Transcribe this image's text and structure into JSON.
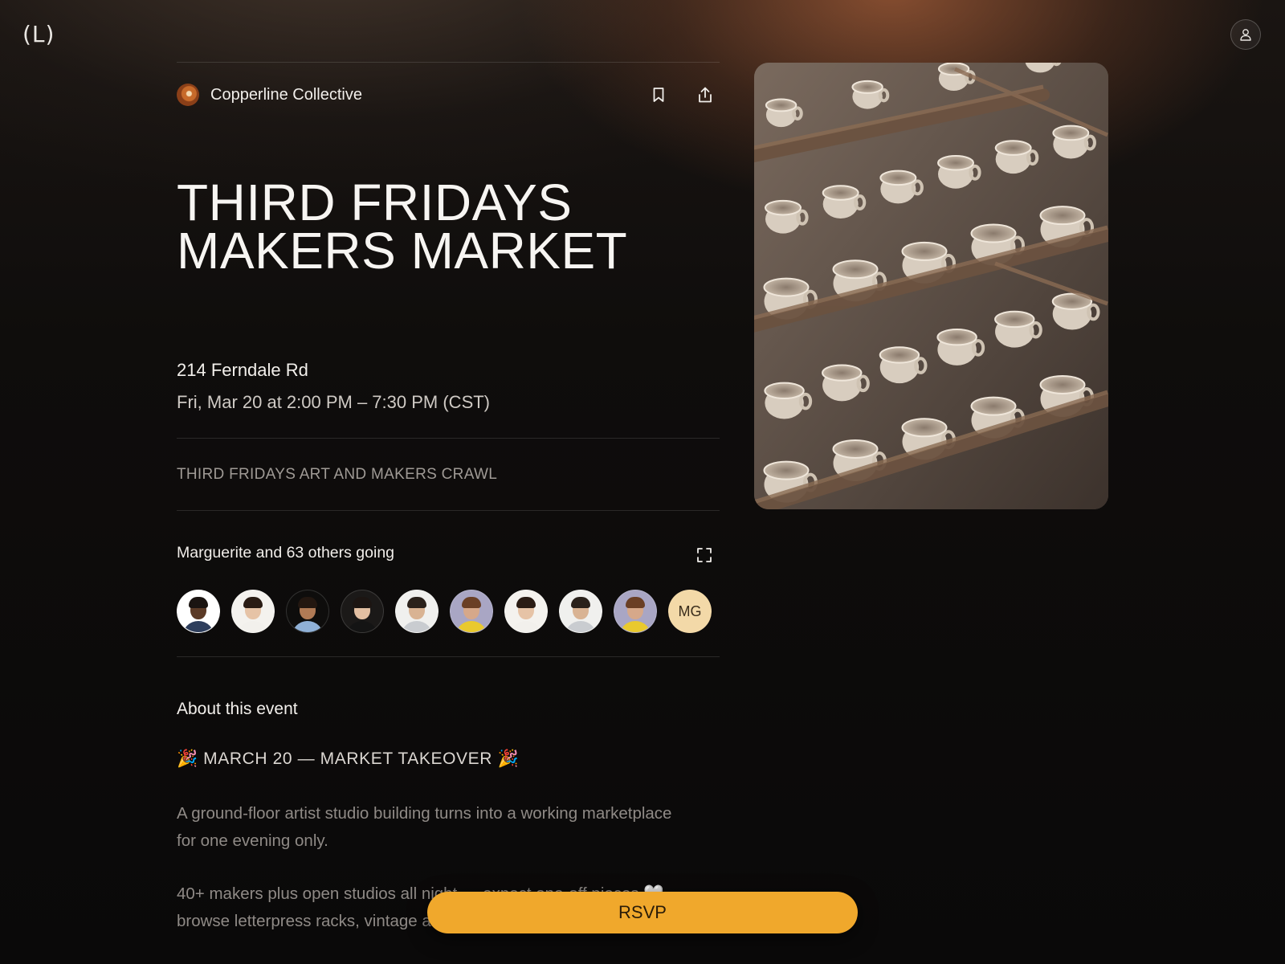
{
  "app": {
    "logo_text": "(L)"
  },
  "header": {
    "account_icon": "person-icon"
  },
  "event": {
    "host_name": "Copperline Collective",
    "title_line_1": "THIRD FRIDAYS",
    "title_line_2": "MAKERS MARKET",
    "location": "214 Ferndale Rd",
    "datetime": "Fri, Mar 20 at 2:00 PM – 7:30 PM (CST)",
    "series": "THIRD FRIDAYS ART AND MAKERS CRAWL",
    "actions": {
      "save_icon": "bookmark-icon",
      "share_icon": "share-icon"
    }
  },
  "attendees": {
    "summary": "Marguerite and 63 others going",
    "expand_icon": "expand-icon",
    "avatars": [
      {
        "kind": "photo",
        "skin": "#5b3a26",
        "hair": "#1a1411",
        "shirt": "#2e3e5c",
        "bg": "#ffffff"
      },
      {
        "kind": "photo",
        "skin": "#e6c3a6",
        "hair": "#2a1c14",
        "shirt": "#f2f0ec",
        "bg": "#f4f2ee"
      },
      {
        "kind": "photo",
        "skin": "#b07a55",
        "hair": "#231710",
        "shirt": "#8fb0d6",
        "bg": "#0e0d0c"
      },
      {
        "kind": "photo",
        "skin": "#e2bfa2",
        "hair": "#1c1512",
        "shirt": "#141414",
        "bg": "#1b1918"
      },
      {
        "kind": "photo",
        "skin": "#d9b393",
        "hair": "#2a211b",
        "shirt": "#c9ccd0",
        "bg": "#f0f0ee"
      },
      {
        "kind": "photo",
        "skin": "#d6a88a",
        "hair": "#6a3f25",
        "shirt": "#e9c92e",
        "bg": "#a9a6c4"
      },
      {
        "kind": "photo",
        "skin": "#e6c3a6",
        "hair": "#2a1c14",
        "shirt": "#f2f0ec",
        "bg": "#f4f2ee"
      },
      {
        "kind": "photo",
        "skin": "#d9b393",
        "hair": "#2a211b",
        "shirt": "#c9ccd0",
        "bg": "#f0f0ee"
      },
      {
        "kind": "photo",
        "skin": "#d6a88a",
        "hair": "#6a3f25",
        "shirt": "#e9c92e",
        "bg": "#a9a6c4"
      }
    ],
    "initials_avatar": "MG"
  },
  "about": {
    "heading": "About this event",
    "takeover": "🎉 MARCH 20 — MARKET TAKEOVER 🎉",
    "paragraph_1": "A ground-floor artist studio building turns into a working marketplace for one evening only.",
    "paragraph_2": "40+ makers plus open studios all night — expect one-off pieces 🤍 browse letterpress racks, vintage and more."
  },
  "cta": {
    "rsvp_label": "RSVP"
  },
  "colors": {
    "accent": "#f0a82c",
    "background": "#0b0a0a"
  }
}
